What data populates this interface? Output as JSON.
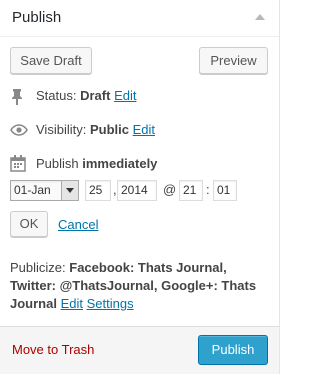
{
  "header": {
    "title": "Publish"
  },
  "actions": {
    "save_draft": "Save Draft",
    "preview": "Preview"
  },
  "status": {
    "label": "Status:",
    "value": "Draft",
    "edit": "Edit"
  },
  "visibility": {
    "label": "Visibility:",
    "value": "Public",
    "edit": "Edit"
  },
  "schedule": {
    "label": "Publish",
    "value": "immediately",
    "month": "01-Jan",
    "day": "25",
    "year": "2014",
    "at": "@",
    "hour": "21",
    "colon": ":",
    "minute": "01",
    "comma": ",",
    "ok": "OK",
    "cancel": "Cancel"
  },
  "publicize": {
    "label": "Publicize:",
    "value": "Facebook: Thats Journal, Twitter: @ThatsJournal, Google+: Thats Journal",
    "edit": "Edit",
    "settings": "Settings"
  },
  "footer": {
    "trash": "Move to Trash",
    "publish": "Publish"
  },
  "colors": {
    "accent": "#0073aa",
    "publish_button": "#2ea2cc",
    "trash": "#aa0000"
  },
  "icons": [
    "collapse-arrow-icon",
    "pin-icon",
    "eye-icon",
    "calendar-icon"
  ]
}
